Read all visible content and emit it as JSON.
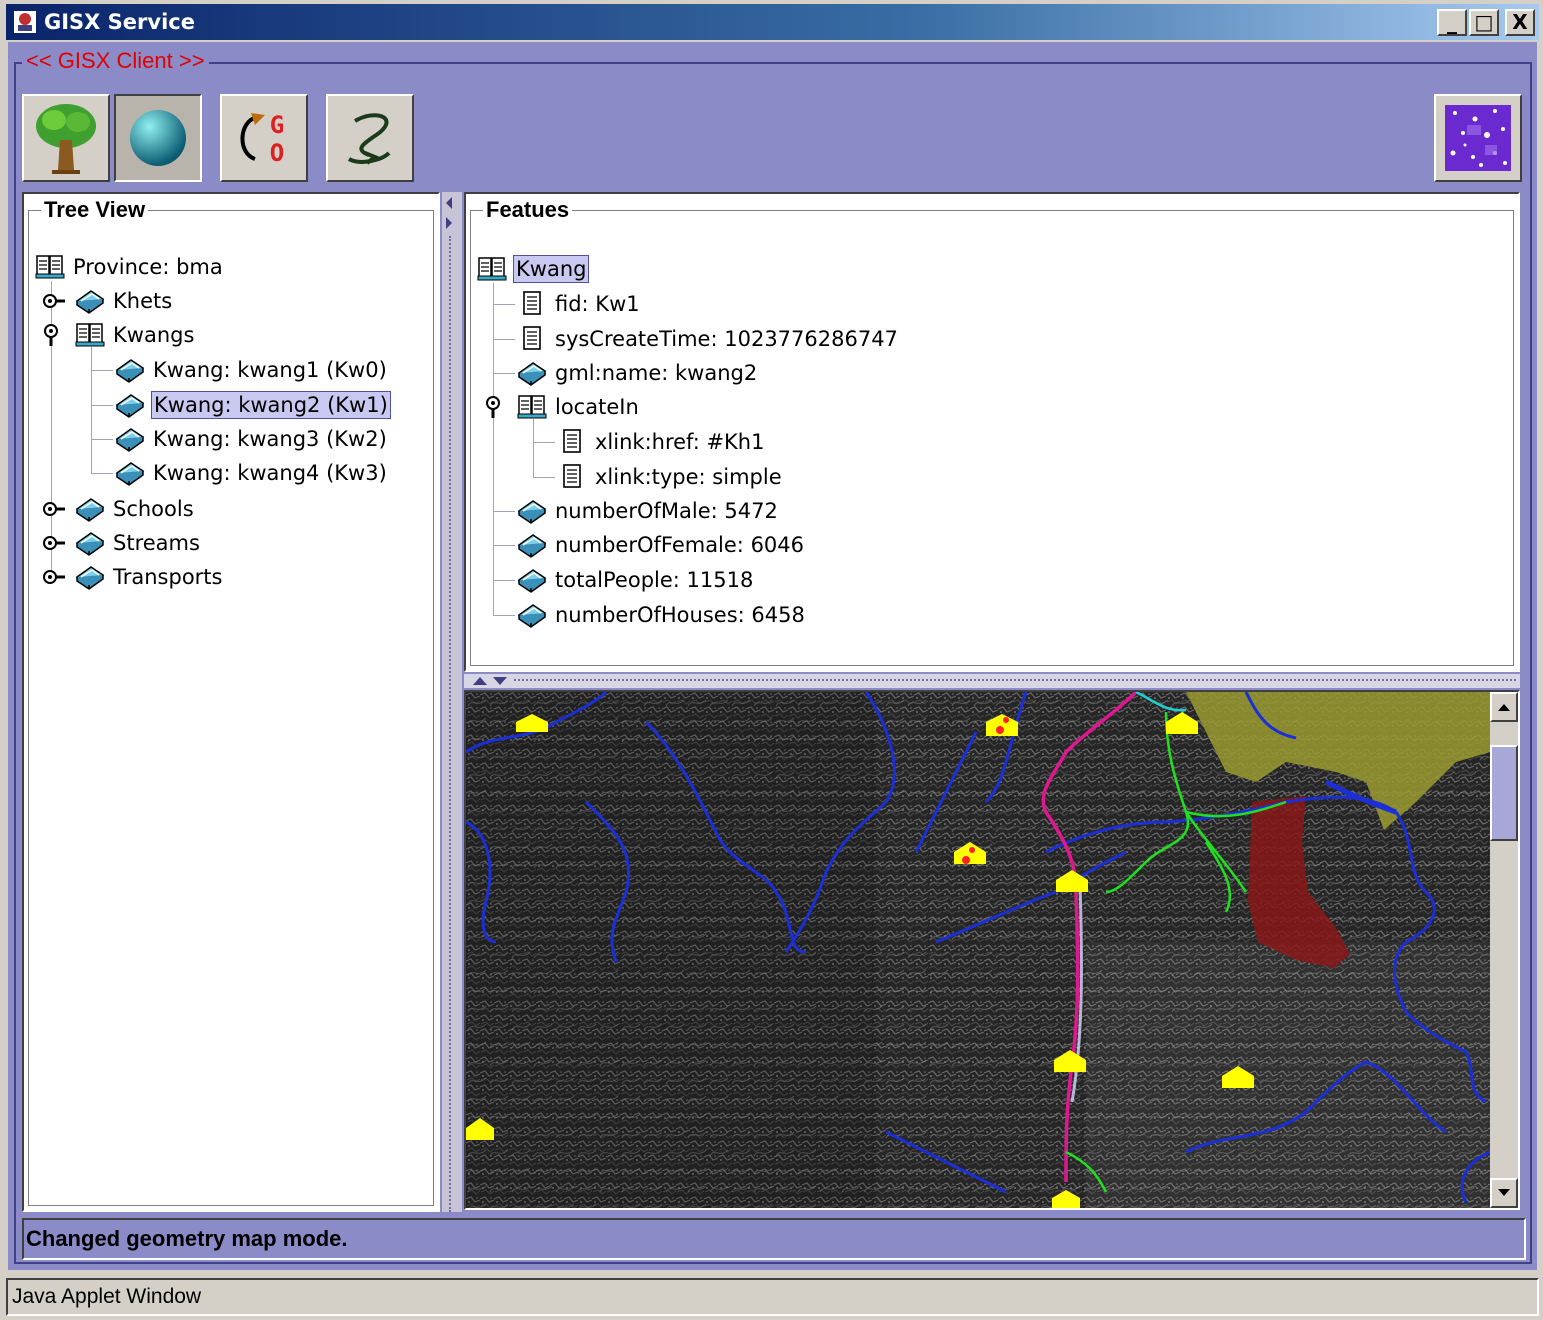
{
  "window": {
    "title": "GISX Service",
    "minimize_label": "_",
    "maximize_label": "□",
    "close_label": "X"
  },
  "client": {
    "legend": "<< GISX Client >>"
  },
  "toolbar": {
    "buttons": [
      {
        "icon": "tree-icon"
      },
      {
        "icon": "globe-icon"
      },
      {
        "icon": "go-refresh-icon",
        "letter_g": "G",
        "letter_o": "O"
      },
      {
        "icon": "link-icon"
      },
      {
        "icon": "starfield-icon"
      }
    ]
  },
  "tree": {
    "title": "Tree View",
    "nodes": [
      {
        "label": "Province: bma",
        "icon": "book-open-icon"
      },
      {
        "label": "Khets",
        "icon": "book-closed-icon",
        "toggle": "collapsed"
      },
      {
        "label": "Kwangs",
        "icon": "book-open-icon",
        "toggle": "expanded"
      },
      {
        "label": "Kwang: kwang1 (Kw0)",
        "icon": "book-closed-icon"
      },
      {
        "label": "Kwang: kwang2 (Kw1)",
        "icon": "book-closed-icon",
        "selected": true
      },
      {
        "label": "Kwang: kwang3 (Kw2)",
        "icon": "book-closed-icon"
      },
      {
        "label": "Kwang: kwang4 (Kw3)",
        "icon": "book-closed-icon"
      },
      {
        "label": "Schools",
        "icon": "book-closed-icon",
        "toggle": "collapsed"
      },
      {
        "label": "Streams",
        "icon": "book-closed-icon",
        "toggle": "collapsed"
      },
      {
        "label": "Transports",
        "icon": "book-closed-icon",
        "toggle": "collapsed"
      }
    ]
  },
  "features": {
    "title": "Featues",
    "nodes": [
      {
        "label": "Kwang",
        "icon": "book-open-icon",
        "selected": true
      },
      {
        "label": "fid: Kw1",
        "icon": "document-icon"
      },
      {
        "label": "sysCreateTime: 1023776286747",
        "icon": "document-icon"
      },
      {
        "label": "gml:name: kwang2",
        "icon": "book-closed-icon"
      },
      {
        "label": "locateIn",
        "icon": "book-open-icon",
        "toggle": "expanded"
      },
      {
        "label": "xlink:href: #Kh1",
        "icon": "document-icon"
      },
      {
        "label": "xlink:type: simple",
        "icon": "document-icon"
      },
      {
        "label": "numberOfMale: 5472",
        "icon": "book-closed-icon"
      },
      {
        "label": "numberOfFemale: 6046",
        "icon": "book-closed-icon"
      },
      {
        "label": "totalPeople: 11518",
        "icon": "book-closed-icon"
      },
      {
        "label": "numberOfHouses: 6458",
        "icon": "book-closed-icon"
      }
    ]
  },
  "map": {
    "colors": {
      "stream": "#1a2fd8",
      "road": "#e01890",
      "transport": "#20e020",
      "school": "#ffff00",
      "area_yellow": "#9a9a30",
      "area_red": "#8a1818"
    },
    "scrollbar_position": 0.06
  },
  "status": {
    "text": "Changed geometry map mode."
  },
  "footer": {
    "text": "Java Applet Window"
  }
}
